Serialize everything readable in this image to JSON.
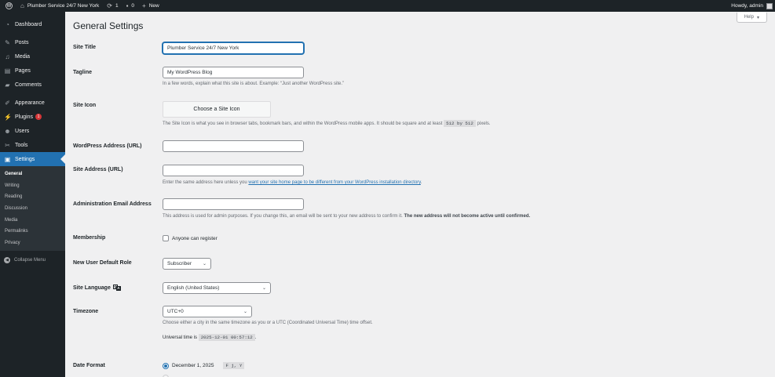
{
  "adminbar": {
    "site_name": "Plumber Service 24/7 New York",
    "updates_count": "1",
    "comments_count": "0",
    "new_label": "New",
    "howdy": "Howdy, admin"
  },
  "sidebar": {
    "items": [
      {
        "label": "Dashboard",
        "icon": "dashboard-icon"
      },
      {
        "label": "Posts",
        "icon": "pin-icon"
      },
      {
        "label": "Media",
        "icon": "media-icon"
      },
      {
        "label": "Pages",
        "icon": "page-icon"
      },
      {
        "label": "Comments",
        "icon": "comment-icon"
      },
      {
        "label": "Appearance",
        "icon": "brush-icon"
      },
      {
        "label": "Plugins",
        "icon": "plug-icon",
        "badge": "1"
      },
      {
        "label": "Users",
        "icon": "user-icon"
      },
      {
        "label": "Tools",
        "icon": "wrench-icon"
      },
      {
        "label": "Settings",
        "icon": "settings-icon"
      }
    ],
    "submenu": [
      "General",
      "Writing",
      "Reading",
      "Discussion",
      "Media",
      "Permalinks",
      "Privacy"
    ],
    "collapse_label": "Collapse Menu"
  },
  "page": {
    "help_label": "Help",
    "title": "General Settings"
  },
  "form": {
    "site_title": {
      "label": "Site Title",
      "value": "Plumber Service 24/7 New York"
    },
    "tagline": {
      "label": "Tagline",
      "value": "My WordPress Blog",
      "desc": "In a few words, explain what this site is about. Example: “Just another WordPress site.”"
    },
    "site_icon": {
      "label": "Site Icon",
      "button": "Choose a Site Icon",
      "desc_before": "The Site Icon is what you see in browser tabs, bookmark bars, and within the WordPress mobile apps. It should be square and at least ",
      "desc_code": "512 by 512",
      "desc_after": " pixels."
    },
    "wp_address": {
      "label": "WordPress Address (URL)",
      "value": ""
    },
    "site_address": {
      "label": "Site Address (URL)",
      "value": "",
      "desc_before": "Enter the same address here unless you ",
      "desc_link": "want your site home page to be different from your WordPress installation directory",
      "desc_after": "."
    },
    "admin_email": {
      "label": "Administration Email Address",
      "value": "",
      "desc_plain": "This address is used for admin purposes. If you change this, an email will be sent to your new address to confirm it. ",
      "desc_strong": "The new address will not become active until confirmed."
    },
    "membership": {
      "label": "Membership",
      "checkbox": "Anyone can register"
    },
    "default_role": {
      "label": "New User Default Role",
      "value": "Subscriber"
    },
    "site_language": {
      "label": "Site Language",
      "value": "English (United States)"
    },
    "timezone": {
      "label": "Timezone",
      "value": "UTC+0",
      "desc": "Choose either a city in the same timezone as you or a UTC (Coordinated Universal Time) time offset.",
      "universal_label": "Universal time is ",
      "universal_code": "2025-12-01 00:57:12",
      "universal_after": "."
    },
    "date_format": {
      "label": "Date Format",
      "option": "December 1, 2025",
      "code": "F j, Y"
    }
  }
}
